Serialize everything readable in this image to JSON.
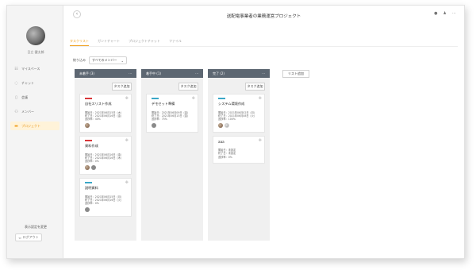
{
  "sidebar": {
    "user_name": "日立 健太郎",
    "items": [
      {
        "label": "マイスペース",
        "icon": "grid-icon",
        "active": false
      },
      {
        "label": "チャット",
        "icon": "chat-icon",
        "active": false
      },
      {
        "label": "会議",
        "icon": "meeting-icon",
        "active": false
      },
      {
        "label": "メンバー",
        "icon": "members-icon",
        "active": false
      },
      {
        "label": "プロジェクト",
        "icon": "folder-icon",
        "active": true
      }
    ],
    "change_link": "表示設定を変更",
    "logout_label": "ログアウト"
  },
  "header": {
    "back_icon": "chevron-left-icon",
    "title": "送配電事業者の業務運営プロジェクト",
    "icons": [
      "info-icon",
      "person-icon",
      "more-icon"
    ]
  },
  "tabs": [
    {
      "label": "タスクリスト",
      "active": true
    },
    {
      "label": "ガントチャート",
      "active": false
    },
    {
      "label": "プロジェクトチャット",
      "active": false
    },
    {
      "label": "ファイル",
      "active": false
    }
  ],
  "filter": {
    "label": "絞り込み",
    "value": "すべてのメンバー"
  },
  "columns": [
    {
      "title": "未着手 (3)",
      "add_label": "タスク追加",
      "cards": [
        {
          "bar_color": "#d9383b",
          "title": "自社スリスト作成",
          "start": "開始日：2021年06月15日（木）",
          "end": "終了日：2021年06月16日（金）",
          "progress": "進捗率：40%",
          "avatars": [
            "brown"
          ]
        },
        {
          "bar_color": "#d9383b",
          "title": "資料作成",
          "start": "開始日：2021年06月16日（金）",
          "end": "終了日：2021年06月16日（木）",
          "progress": "進捗率：0%",
          "avatars": [
            "brown",
            "gray"
          ]
        },
        {
          "bar_color": "#3aa7c7",
          "title": "説明資料",
          "start": "開始日：2021年06月15日（月）",
          "end": "終了日：2021年06月16日（火）",
          "progress": "進捗率：0%",
          "avatars": [
            "gray"
          ]
        }
      ]
    },
    {
      "title": "着手中 (1)",
      "add_label": "タスク追加",
      "cards": [
        {
          "bar_color": "#3aa7c7",
          "title": "デモセット準備",
          "start": "開始日：2021年06月09日（金）",
          "end": "終了日：2021年06月13日（金）",
          "progress": "進捗率：75%",
          "avatars": [
            "gray"
          ]
        }
      ]
    },
    {
      "title": "完了 (2)",
      "add_label": "タスク追加",
      "cards": [
        {
          "bar_color": "#3aa7c7",
          "title": "システム環境作成",
          "start": "開始日：2021年06月02日（月）",
          "end": "終了日：2021年06月08日（火）",
          "progress": "進捗率：100%",
          "avatars": [
            "brown",
            "light"
          ]
        },
        {
          "bar_color": "",
          "title": "aaa",
          "start": "開始日：未設定",
          "end": "終了日：未設定",
          "progress": "進捗率：0%",
          "avatars": []
        }
      ]
    }
  ],
  "list_add_label": "リスト追加"
}
